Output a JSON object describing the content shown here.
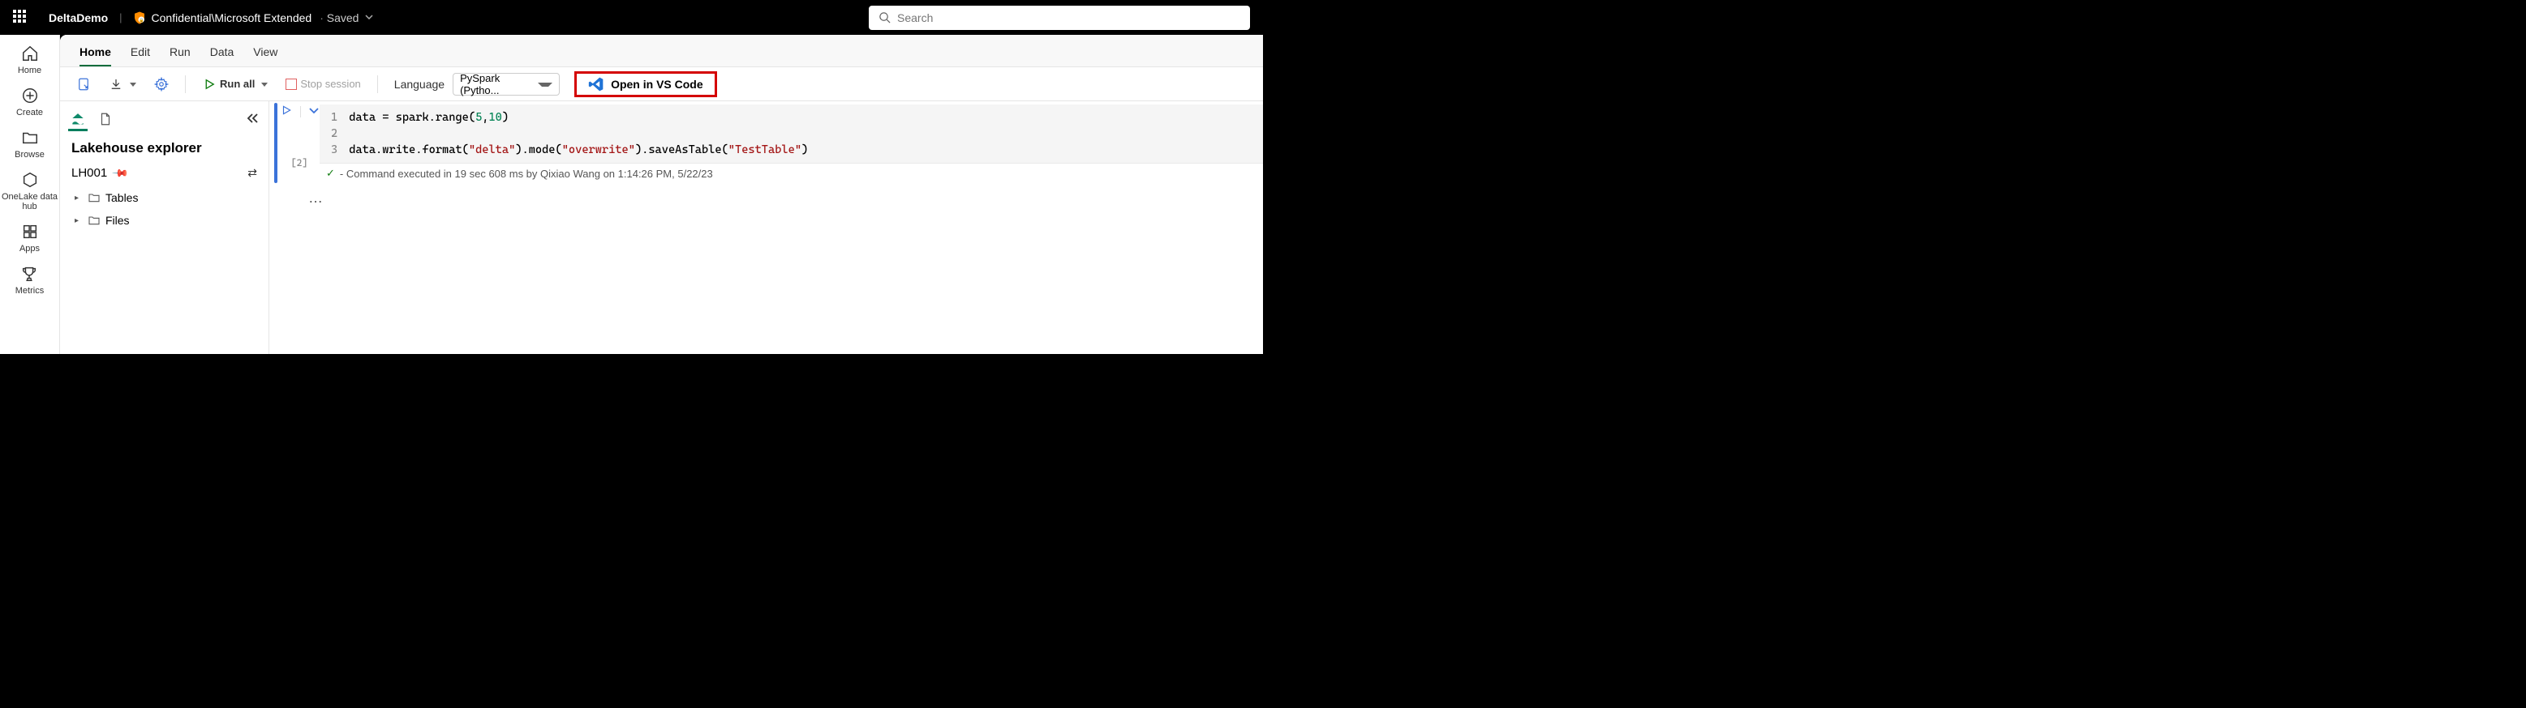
{
  "header": {
    "app_name": "DeltaDemo",
    "confidential_label": "Confidential\\Microsoft Extended",
    "saved_label": "Saved",
    "search_placeholder": "Search"
  },
  "left_rail": {
    "items": [
      {
        "label": "Home",
        "icon": "home"
      },
      {
        "label": "Create",
        "icon": "plus-circle"
      },
      {
        "label": "Browse",
        "icon": "folder"
      },
      {
        "label": "OneLake data hub",
        "icon": "hexagon"
      },
      {
        "label": "Apps",
        "icon": "apps"
      },
      {
        "label": "Metrics",
        "icon": "trophy"
      }
    ]
  },
  "tabs": {
    "items": [
      "Home",
      "Edit",
      "Run",
      "Data",
      "View"
    ],
    "active_index": 0
  },
  "toolbar": {
    "run_all_label": "Run all",
    "stop_session_label": "Stop session",
    "language_label": "Language",
    "language_value": "PySpark (Pytho...",
    "vscode_label": "Open in VS Code"
  },
  "explorer": {
    "title": "Lakehouse explorer",
    "lakehouse_name": "LH001",
    "tree": [
      {
        "label": "Tables"
      },
      {
        "label": "Files"
      }
    ]
  },
  "cell": {
    "number_label": "[2]",
    "lines": [
      "1",
      "2",
      "3"
    ],
    "code_line1_pre": "data = spark.range(",
    "code_line1_n1": "5",
    "code_line1_sep": ",",
    "code_line1_n2": "10",
    "code_line1_post": ")",
    "code_line3_a": "data.write.format(",
    "code_line3_s1": "\"delta\"",
    "code_line3_b": ").mode(",
    "code_line3_s2": "\"overwrite\"",
    "code_line3_c": ").saveAsTable(",
    "code_line3_s3": "\"TestTable\"",
    "code_line3_d": ")",
    "status": "- Command executed in 19 sec 608 ms by Qixiao Wang on 1:14:26 PM, 5/22/23",
    "more": "…"
  }
}
